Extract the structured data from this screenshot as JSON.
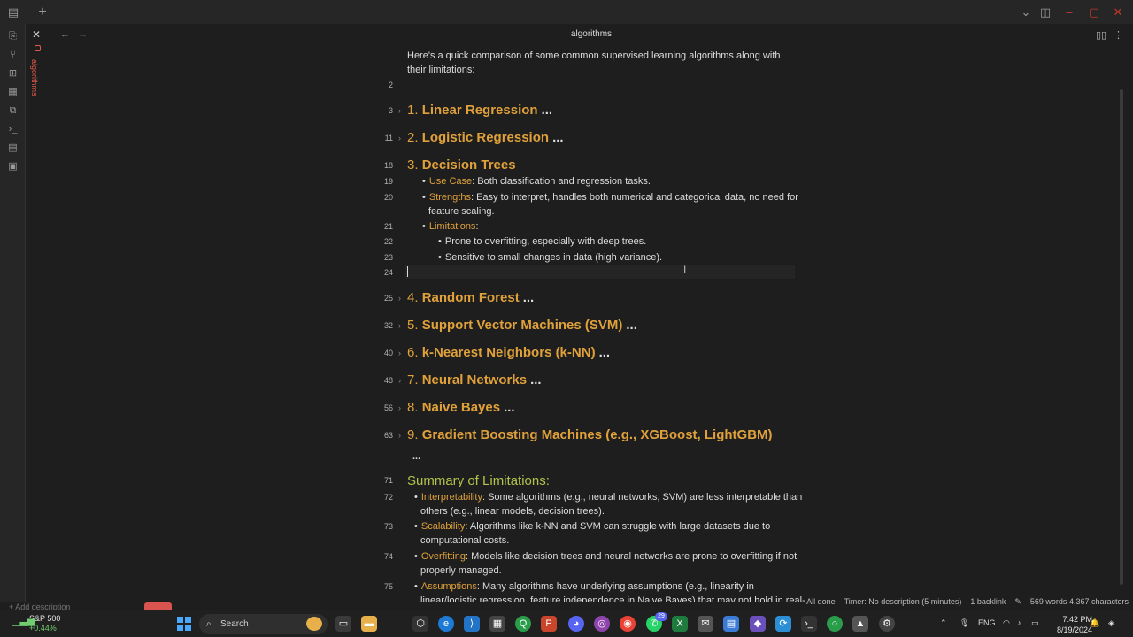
{
  "window": {
    "title": "algorithms"
  },
  "tab": {
    "label": "algorithms"
  },
  "editor": {
    "intro_line": "Here's a quick comparison of some common supervised learning algorithms along with",
    "intro_line2": "their limitations:",
    "fold_dots": "...",
    "headings": [
      {
        "line": "3",
        "num": "1.",
        "title": "Linear Regression"
      },
      {
        "line": "11",
        "num": "2.",
        "title": "Logistic Regression"
      },
      {
        "line": "18",
        "num": "3.",
        "title": "Decision Trees"
      },
      {
        "line": "25",
        "num": "4.",
        "title": "Random Forest"
      },
      {
        "line": "32",
        "num": "5.",
        "title": "Support Vector Machines (SVM)"
      },
      {
        "line": "40",
        "num": "6.",
        "title": "k-Nearest Neighbors (k-NN)"
      },
      {
        "line": "48",
        "num": "7.",
        "title": "Neural Networks"
      },
      {
        "line": "56",
        "num": "8.",
        "title": "Naive Bayes"
      },
      {
        "line": "63",
        "num": "9.",
        "title": "Gradient Boosting Machines (e.g., XGBoost, LightGBM)"
      }
    ],
    "line_numbers": {
      "l2": "2",
      "l19": "19",
      "l20": "20",
      "l21": "21",
      "l22": "22",
      "l23": "23",
      "l24": "24",
      "l71": "71",
      "l72": "72",
      "l73": "73",
      "l74": "74",
      "l75": "75"
    },
    "decision_trees": {
      "use_case_key": "Use Case",
      "use_case_val": ": Both classification and regression tasks.",
      "strengths_key": "Strengths",
      "strengths_val": ": Easy to interpret, handles both numerical and categorical data, no need for",
      "strengths_val2": "feature scaling.",
      "limitations_key": "Limitations",
      "limitations_colon": ":",
      "lim1": "Prone to overfitting, especially with deep trees.",
      "lim2": "Sensitive to small changes in data (high variance)."
    },
    "summary": {
      "title": "Summary of Limitations:",
      "interpretability_key": "Interpretability",
      "interpretability_val": ": Some algorithms (e.g., neural networks, SVM) are less interpretable than",
      "interpretability_val2": "others (e.g., linear models, decision trees).",
      "scalability_key": "Scalability",
      "scalability_val": ": Algorithms like k-NN and SVM can struggle with large datasets due to",
      "scalability_val2": "computational costs.",
      "overfitting_key": "Overfitting",
      "overfitting_val": ": Models like decision trees and neural networks are prone to overfitting if not",
      "overfitting_val2": "properly managed.",
      "assumptions_key": "Assumptions",
      "assumptions_val": ": Many algorithms have underlying assumptions (e.g., linearity in",
      "assumptions_val2": "linear/logistic regression, feature independence in Naive Bayes) that may not hold in real-"
    }
  },
  "statusbar": {
    "sync": "All done",
    "timer": "Timer: No description (5 minutes)",
    "backlinks": "1 backlink",
    "words": "569 words",
    "chars": "4,367 characters"
  },
  "add_description": "+ Add description",
  "taskbar": {
    "stock_name": "S&P 500",
    "stock_change": "+0.44%",
    "search_label": "Search",
    "lang": "ENG",
    "time": "7:42 PM",
    "date": "8/19/2024",
    "badge": "29"
  }
}
